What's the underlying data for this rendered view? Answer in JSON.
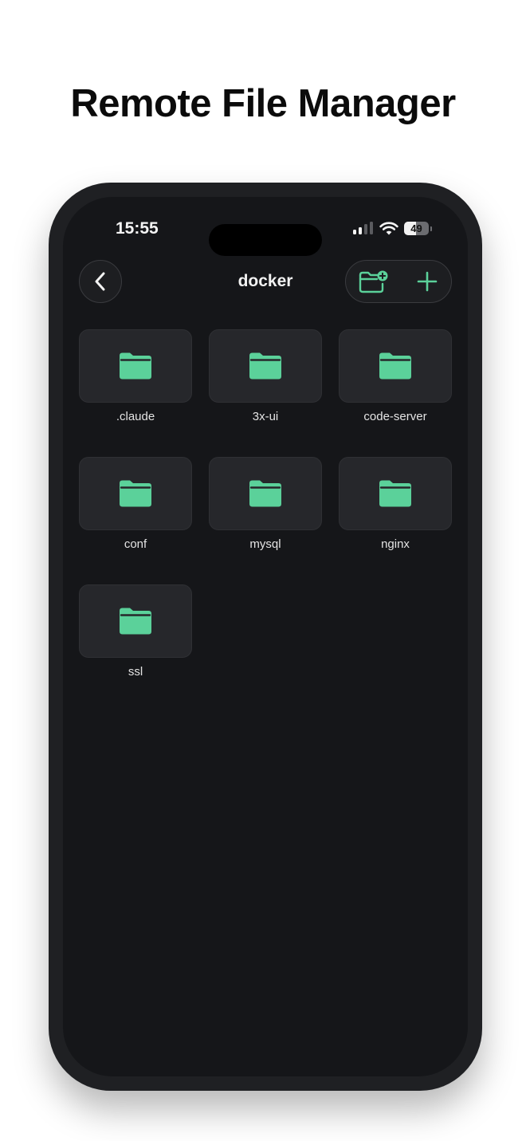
{
  "headline": "Remote File Manager",
  "status_bar": {
    "time": "15:55",
    "battery_level": "49",
    "battery_fraction": 0.49,
    "signal_bars_active": 2,
    "signal_bars_total": 4
  },
  "nav": {
    "title": "docker",
    "back_icon": "chevron-left-icon",
    "new_folder_icon": "folder-plus-icon",
    "add_icon": "plus-icon"
  },
  "folders": [
    {
      "name": ".claude"
    },
    {
      "name": "3x-ui"
    },
    {
      "name": "code-server"
    },
    {
      "name": "conf"
    },
    {
      "name": "mysql"
    },
    {
      "name": "nginx"
    },
    {
      "name": "ssl"
    }
  ],
  "colors": {
    "accent": "#5bd19a",
    "background": "#151619",
    "tile": "#26272b",
    "phone_frame": "#1f2023"
  }
}
